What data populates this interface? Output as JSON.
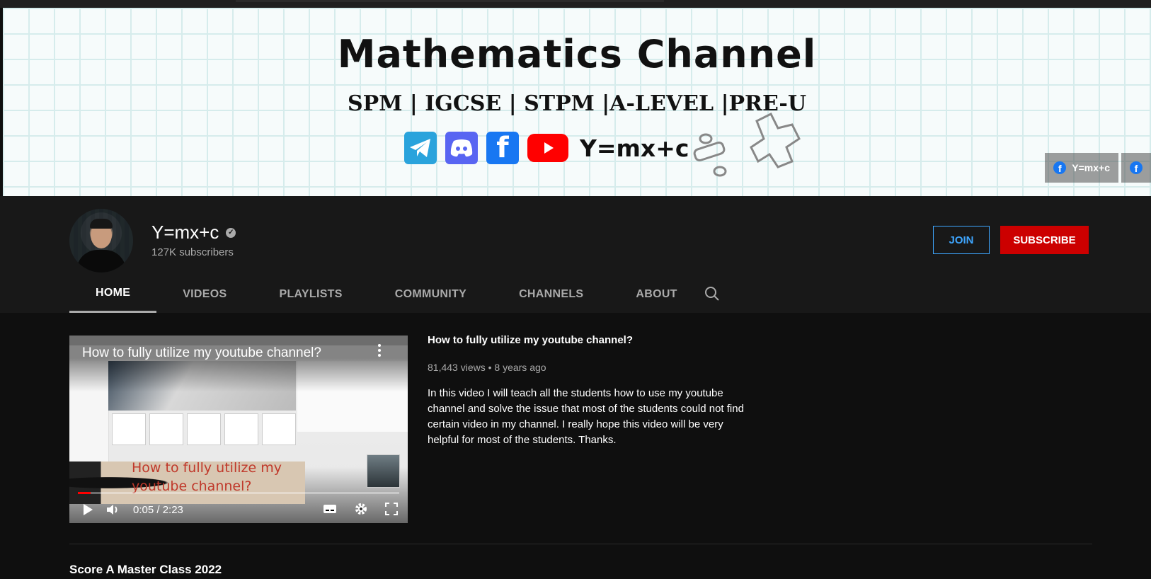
{
  "banner": {
    "title": "Mathematics Channel",
    "subtitle": "SPM | IGCSE | STPM |A-LEVEL |PRE-U",
    "handle": "Y=mx+c",
    "social_icons": [
      "telegram-icon",
      "discord-icon",
      "facebook-icon",
      "youtube-icon"
    ],
    "links": [
      {
        "label": "Y=mx+c",
        "icon": "facebook-icon"
      },
      {
        "label": "",
        "icon": "facebook-icon"
      }
    ]
  },
  "channel": {
    "name": "Y=mx+c",
    "subscribers": "127K subscribers",
    "join_label": "JOIN",
    "subscribe_label": "SUBSCRIBE"
  },
  "tabs": [
    {
      "label": "HOME",
      "active": true
    },
    {
      "label": "VIDEOS",
      "active": false
    },
    {
      "label": "PLAYLISTS",
      "active": false
    },
    {
      "label": "COMMUNITY",
      "active": false
    },
    {
      "label": "CHANNELS",
      "active": false
    },
    {
      "label": "ABOUT",
      "active": false
    }
  ],
  "featured_video": {
    "player_title": "How to fully utilize my youtube channel?",
    "overlay_text_line1": "How to fully utilize my",
    "overlay_text_line2": "youtube channel?",
    "current_time": "0:05 / 2:23",
    "progress_percent": 4,
    "title": "How to fully utilize my youtube channel?",
    "meta": "81,443 views • 8 years ago",
    "description": "In this video I will teach all the students how to use my youtube channel and solve the issue that most of the students could not find certain video in my channel. I really hope this video will be very helpful for most of the students. Thanks."
  },
  "next_section": {
    "title": "Score A Master Class 2022"
  },
  "colors": {
    "subscribe": "#cc0000",
    "join": "#3ea6ff",
    "background": "#0f0f0f",
    "header": "#181818"
  }
}
